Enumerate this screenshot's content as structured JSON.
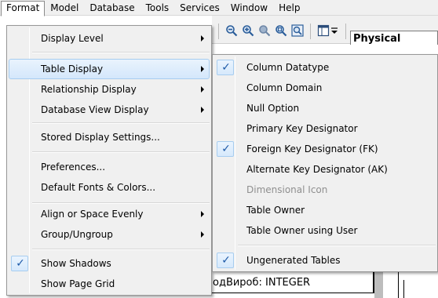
{
  "menubar": {
    "items": [
      "Format",
      "Model",
      "Database",
      "Tools",
      "Services",
      "Window",
      "Help"
    ]
  },
  "toolbar": {
    "view_mode": "Physical"
  },
  "format_menu": {
    "items": [
      {
        "label": "Display Level",
        "submenu": true
      },
      {
        "label": "Table Display",
        "submenu": true,
        "highlighted": true
      },
      {
        "label": "Relationship Display",
        "submenu": true
      },
      {
        "label": "Database View Display",
        "submenu": true
      },
      {
        "label": "Stored Display Settings..."
      },
      {
        "label": "Preferences..."
      },
      {
        "label": "Default Fonts & Colors..."
      },
      {
        "label": "Align or Space Evenly",
        "submenu": true
      },
      {
        "label": "Group/Ungroup",
        "submenu": true
      },
      {
        "label": "Show Shadows",
        "checked": true
      },
      {
        "label": "Show Page Grid"
      }
    ]
  },
  "table_display_submenu": {
    "items": [
      {
        "label": "Column Datatype",
        "checked": true
      },
      {
        "label": "Column Domain"
      },
      {
        "label": "Null Option"
      },
      {
        "label": "Primary Key Designator"
      },
      {
        "label": "Foreign Key Designator (FK)",
        "checked": true
      },
      {
        "label": "Alternate Key Designator (AK)"
      },
      {
        "label": "Dimensional Icon",
        "disabled": true
      },
      {
        "label": "Table Owner"
      },
      {
        "label": "Table Owner using User"
      },
      {
        "label": "Ungenerated Tables",
        "checked": true
      }
    ]
  },
  "canvas": {
    "entity_attribute": "одВироб: INTEGER"
  },
  "icons": {
    "check": "✓"
  }
}
